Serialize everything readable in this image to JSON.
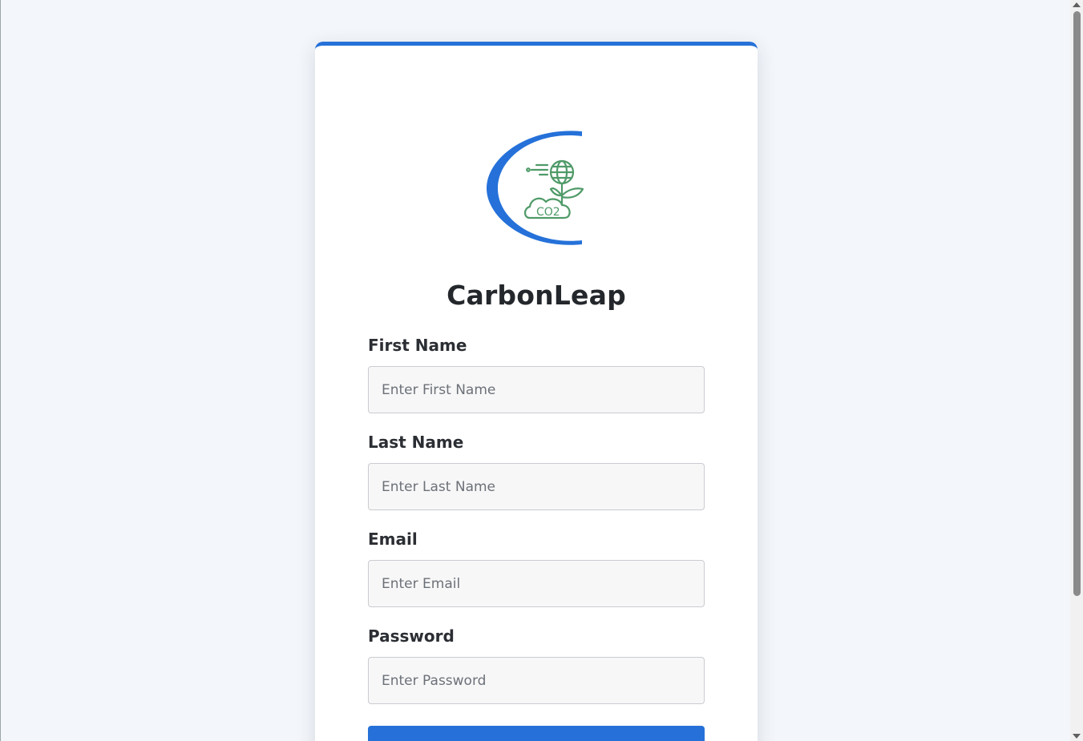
{
  "brand": {
    "name": "CarbonLeap",
    "logo_text": "CO2",
    "logo_colors": {
      "ring": "#2571d9",
      "icon": "#4f9a68"
    }
  },
  "form": {
    "first_name": {
      "label": "First Name",
      "placeholder": "Enter First Name",
      "value": ""
    },
    "last_name": {
      "label": "Last Name",
      "placeholder": "Enter Last Name",
      "value": ""
    },
    "email": {
      "label": "Email",
      "placeholder": "Enter Email",
      "value": ""
    },
    "password": {
      "label": "Password",
      "placeholder": "Enter Password",
      "value": ""
    },
    "submit_label": ""
  },
  "colors": {
    "accent": "#2571d9",
    "background": "#f3f6fa",
    "card": "#ffffff",
    "input_bg": "#f7f7f8"
  }
}
